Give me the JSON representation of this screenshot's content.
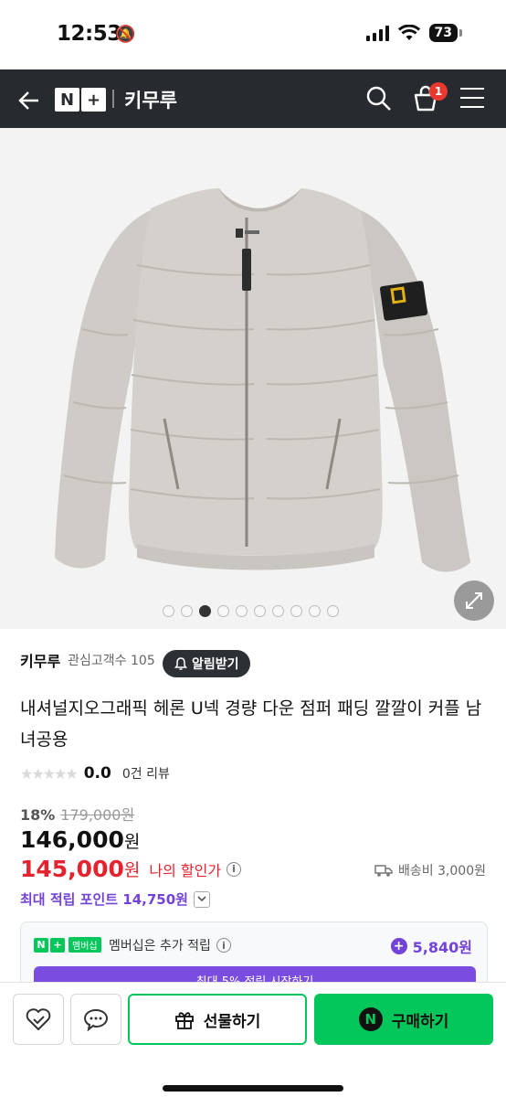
{
  "status_bar": {
    "time": "12:53",
    "battery": "73"
  },
  "nav": {
    "logo_n": "N",
    "logo_plus": "+",
    "store_name": "키무루",
    "cart_count": "1"
  },
  "gallery": {
    "total": 10,
    "active_index": 2
  },
  "seller": {
    "name": "키무루",
    "followers": "관심고객수 105",
    "alarm_label": "알림받기"
  },
  "product": {
    "title": "내셔널지오그래픽 헤론 U넥 경량 다운 점퍼 패딩 깔깔이 커플 남녀공용",
    "rating_score": "0.0",
    "review_count": "0건 리뷰",
    "discount_pct": "18%",
    "original_price": "179,000원",
    "price_value": "146,000",
    "price_unit": "원",
    "my_price_value": "145,000",
    "my_price_unit": "원",
    "my_price_label": "나의 할인가",
    "shipping": "배송비 3,000원",
    "points_label": "최대 적립 포인트 14,750원"
  },
  "membership": {
    "badge_text": "멤버십",
    "label": "멤버십은 추가 적립",
    "points": "5,840원",
    "cta_partial": "최대 5% 적립 시작하기"
  },
  "bottom_bar": {
    "gift_label": "선물하기",
    "buy_label": "구매하기",
    "buy_icon": "N"
  },
  "colors": {
    "nav_bg": "#272a2f",
    "naver_green": "#03c75a",
    "sale_red": "#e5222e",
    "point_purple": "#7342d8"
  }
}
